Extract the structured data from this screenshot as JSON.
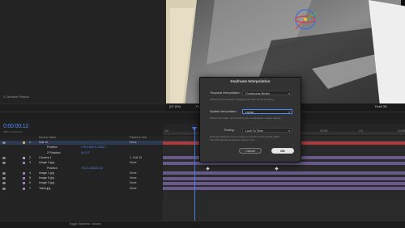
{
  "project": {
    "panel_tab": "S. Archive Photos"
  },
  "viewer": {
    "zoom": "(57.8%)",
    "resolution": "Full",
    "renderer": "Draft 3D"
  },
  "timeline": {
    "timecode": "0:00:00:12",
    "timecode_sub": "00012 (24.00 fps)",
    "columns": {
      "source_name": "Source Name",
      "mode": "Parent & Link"
    },
    "ruler_ticks": [
      "00f",
      "12f",
      "01:00f",
      "12f",
      "02:00f",
      "12f",
      "03:00f"
    ],
    "toggle_label": "Toggle Switches / Modes",
    "rows": [
      {
        "num": "1",
        "name": "Null 10",
        "mode": "None",
        "label_color": "#c9a85a",
        "selected": true
      },
      {
        "num": "",
        "name": "Position",
        "value": "775.0,540.0,1188.7",
        "mode": "",
        "sub": true
      },
      {
        "num": "",
        "name": "Z Rotation",
        "value": "0x-0.0°",
        "mode": "",
        "sub": true
      },
      {
        "num": "2",
        "name": "Camera 1",
        "mode": "1. Null 10",
        "label_color": "#9aa7c4",
        "selected": false
      },
      {
        "num": "3",
        "name": "Image 3.jpg",
        "mode": "None",
        "label_color": "#9d7fb6",
        "selected": false
      },
      {
        "num": "",
        "name": "Position",
        "value": "721.0,1518.0,0.0",
        "mode": "",
        "sub": true
      },
      {
        "num": "4",
        "name": "Image 1.jpg",
        "mode": "None",
        "label_color": "#9d7fb6",
        "selected": false
      },
      {
        "num": "5",
        "name": "Image 5.jpg",
        "mode": "None",
        "label_color": "#9d7fb6",
        "selected": false
      },
      {
        "num": "6",
        "name": "Image 2.jpg",
        "mode": "None",
        "label_color": "#9d7fb6",
        "selected": false
      },
      {
        "num": "7",
        "name": "Table.jpg",
        "mode": "None",
        "label_color": "#9d7fb6",
        "selected": false
      }
    ]
  },
  "dialog": {
    "title": "Keyframe Interpolation",
    "temporal_label": "Temporal Interpolation:",
    "temporal_value": "Continuous Bezier",
    "temporal_note": "Affects how a property changes over time (in the timeline).",
    "spatial_label": "Spatial Interpolation:",
    "spatial_value": "Linear",
    "spatial_note": "Affects the shape of the path (in the composition or layer panel).",
    "roving_label": "Roving:",
    "roving_value": "Lock To Time",
    "roving_note_1": "Roving keyframes move in time to smooth out the speed graph.",
    "roving_note_2": "The first and last keyframes cannot rove.",
    "cancel": "Cancel",
    "ok": "OK"
  },
  "colors": {
    "accent": "#4c8bf5",
    "bar_red": "#b03a3a",
    "bar_purple": "#6a5a8c"
  }
}
